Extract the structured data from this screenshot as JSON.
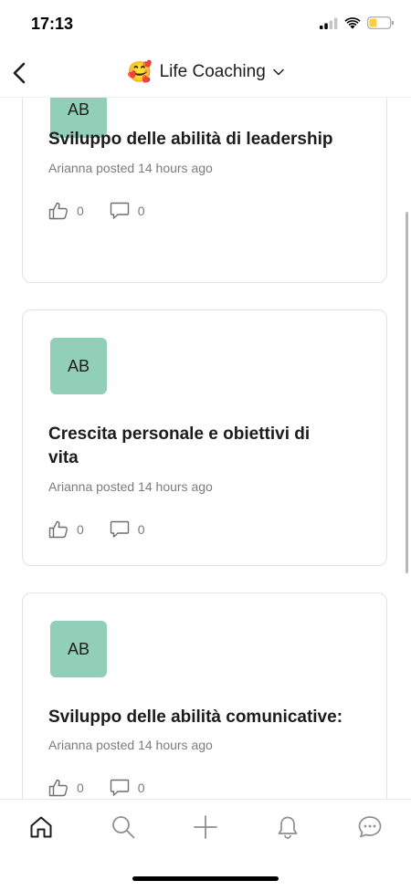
{
  "status_bar": {
    "time": "17:13"
  },
  "header": {
    "emoji": "🥰",
    "title": "Life Coaching"
  },
  "posts": [
    {
      "avatar": "AB",
      "title": "Sviluppo delle abilità di leadership",
      "meta": "Arianna posted 14 hours ago",
      "likes": "0",
      "comments": "0"
    },
    {
      "avatar": "AB",
      "title": "Crescita personale e obiettivi di vita",
      "meta": "Arianna posted 14 hours ago",
      "likes": "0",
      "comments": "0"
    },
    {
      "avatar": "AB",
      "title": "Sviluppo delle abilità comunicative:",
      "meta": "Arianna posted 14 hours ago",
      "likes": "0",
      "comments": "0"
    }
  ],
  "tab_bar": {
    "tabs": [
      "home-icon",
      "search-icon",
      "plus-icon",
      "bell-icon",
      "chat-icon"
    ],
    "active": "home-icon"
  },
  "colors": {
    "avatar_bg": "#92cfb9",
    "battery_fill": "#f7d03c"
  }
}
